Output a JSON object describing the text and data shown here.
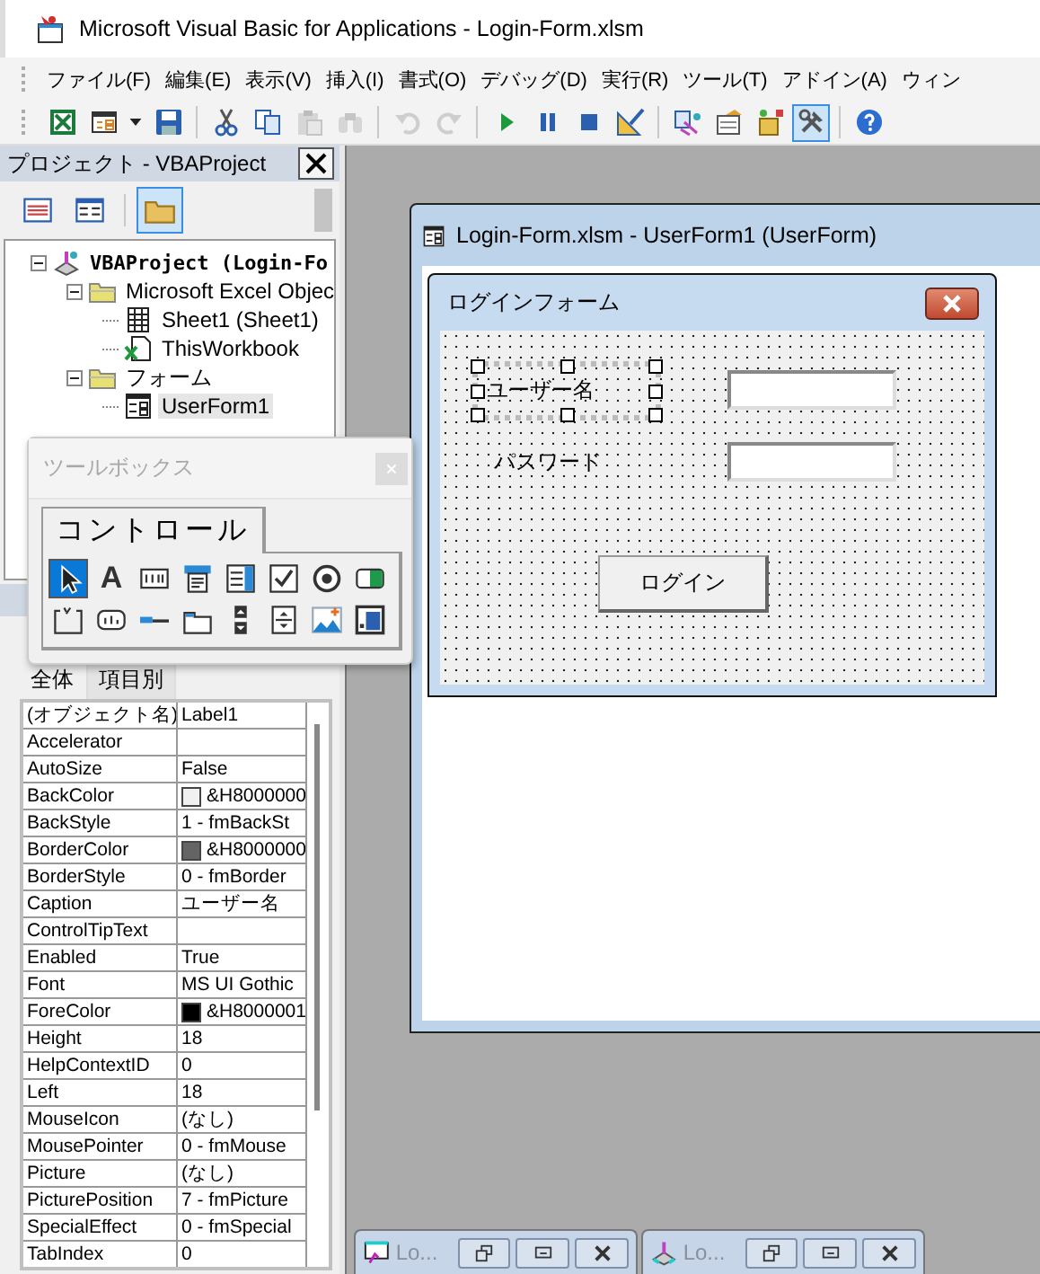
{
  "window": {
    "title": "Microsoft Visual Basic for Applications - Login-Form.xlsm"
  },
  "menu": [
    "ファイル(F)",
    "編集(E)",
    "表示(V)",
    "挿入(I)",
    "書式(O)",
    "デバッグ(D)",
    "実行(R)",
    "ツール(T)",
    "アドイン(A)",
    "ウィン"
  ],
  "toolbar": [
    {
      "kind": "excel",
      "disabled": false,
      "on": false
    },
    {
      "kind": "insert-form",
      "disabled": false,
      "on": false
    },
    {
      "kind": "dropdown",
      "disabled": false,
      "on": false
    },
    {
      "kind": "save",
      "disabled": false,
      "on": false
    },
    {
      "kind": "separator"
    },
    {
      "kind": "cut",
      "disabled": false,
      "on": false
    },
    {
      "kind": "copy",
      "disabled": false,
      "on": false
    },
    {
      "kind": "paste",
      "disabled": true,
      "on": false
    },
    {
      "kind": "find",
      "disabled": true,
      "on": false
    },
    {
      "kind": "separator"
    },
    {
      "kind": "undo",
      "disabled": true,
      "on": false
    },
    {
      "kind": "redo",
      "disabled": true,
      "on": false
    },
    {
      "kind": "separator"
    },
    {
      "kind": "run",
      "disabled": false,
      "on": false
    },
    {
      "kind": "pause",
      "disabled": false,
      "on": false
    },
    {
      "kind": "reset",
      "disabled": false,
      "on": false
    },
    {
      "kind": "design",
      "disabled": false,
      "on": false
    },
    {
      "kind": "separator"
    },
    {
      "kind": "project",
      "disabled": false,
      "on": false
    },
    {
      "kind": "properties",
      "disabled": false,
      "on": false
    },
    {
      "kind": "browser",
      "disabled": false,
      "on": false
    },
    {
      "kind": "toolbox",
      "disabled": false,
      "on": true
    },
    {
      "kind": "separator"
    },
    {
      "kind": "help",
      "disabled": false,
      "on": false
    }
  ],
  "project": {
    "title": "プロジェクト - VBAProject",
    "buttons": [
      {
        "kind": "view-code",
        "on": false
      },
      {
        "kind": "view-object",
        "on": false
      },
      {
        "kind": "folders",
        "on": true
      }
    ],
    "tree": [
      {
        "label": "VBAProject (Login-Fo",
        "kind": "project",
        "expanded": true,
        "selected": false,
        "children": [
          {
            "label": "Microsoft Excel Objec",
            "kind": "folder",
            "expanded": true,
            "selected": false,
            "children": [
              {
                "label": "Sheet1 (Sheet1)",
                "kind": "sheet",
                "selected": false
              },
              {
                "label": "ThisWorkbook",
                "kind": "workbook",
                "selected": false
              }
            ]
          },
          {
            "label": "フォーム",
            "kind": "folder",
            "expanded": true,
            "selected": false,
            "children": [
              {
                "label": "UserForm1",
                "kind": "form",
                "selected": true
              }
            ]
          }
        ]
      }
    ]
  },
  "properties": {
    "tabs": [
      {
        "label": "全体",
        "selected": true
      },
      {
        "label": "項目別",
        "selected": false
      }
    ],
    "rows": [
      {
        "name": "(オブジェクト名)",
        "value": "Label1"
      },
      {
        "name": "Accelerator"
      },
      {
        "name": "AutoSize",
        "value": "False"
      },
      {
        "name": "BackColor",
        "value": "&H8000000",
        "color": "#f0f0f0"
      },
      {
        "name": "BackStyle",
        "value": "1 - fmBackSt"
      },
      {
        "name": "BorderColor",
        "value": "&H8000000",
        "color": "#646464"
      },
      {
        "name": "BorderStyle",
        "value": "0 - fmBorder"
      },
      {
        "name": "Caption",
        "value": "ユーザー名"
      },
      {
        "name": "ControlTipText"
      },
      {
        "name": "Enabled",
        "value": "True"
      },
      {
        "name": "Font",
        "value": "MS UI Gothic"
      },
      {
        "name": "ForeColor",
        "value": "&H8000001",
        "color": "#000000"
      },
      {
        "name": "Height",
        "value": "18"
      },
      {
        "name": "HelpContextID",
        "value": "0"
      },
      {
        "name": "Left",
        "value": "18"
      },
      {
        "name": "MouseIcon",
        "value": "(なし)"
      },
      {
        "name": "MousePointer",
        "value": "0 - fmMouse"
      },
      {
        "name": "Picture",
        "value": "(なし)"
      },
      {
        "name": "PicturePosition",
        "value": "7 - fmPicture"
      },
      {
        "name": "SpecialEffect",
        "value": "0 - fmSpecial"
      },
      {
        "name": "TabIndex",
        "value": "0"
      }
    ]
  },
  "designer": {
    "title": "Login-Form.xlsm - UserForm1 (UserForm)",
    "form": {
      "caption": "ログインフォーム",
      "controls": [
        {
          "kind": "label",
          "text": "ユーザー名",
          "selected": true
        },
        {
          "kind": "textbox",
          "selected": false
        },
        {
          "kind": "label",
          "text": "パスワード",
          "selected": false
        },
        {
          "kind": "textbox",
          "selected": false
        },
        {
          "kind": "button",
          "text": "ログイン",
          "selected": false
        }
      ]
    }
  },
  "minimized": [
    {
      "kind": "code",
      "title": "Lo..."
    },
    {
      "kind": "project",
      "title": "Lo..."
    }
  ],
  "toolbox": {
    "title": "ツールボックス",
    "page": "コントロール",
    "tools": [
      {
        "kind": "pointer",
        "selected": true
      },
      {
        "kind": "label",
        "glyph": "A",
        "selected": false
      },
      {
        "kind": "textbox",
        "selected": false
      },
      {
        "kind": "combobox",
        "selected": false
      },
      {
        "kind": "listbox",
        "selected": false
      },
      {
        "kind": "checkbox",
        "selected": false
      },
      {
        "kind": "option",
        "selected": false
      },
      {
        "kind": "toggle",
        "selected": false
      },
      {
        "kind": "frame",
        "selected": false
      },
      {
        "kind": "command",
        "selected": false
      },
      {
        "kind": "tabstrip",
        "selected": false
      },
      {
        "kind": "multipage",
        "selected": false
      },
      {
        "kind": "scrollbar",
        "selected": false
      },
      {
        "kind": "spin",
        "selected": false
      },
      {
        "kind": "image",
        "selected": false
      },
      {
        "kind": "refedit",
        "selected": false
      }
    ]
  }
}
